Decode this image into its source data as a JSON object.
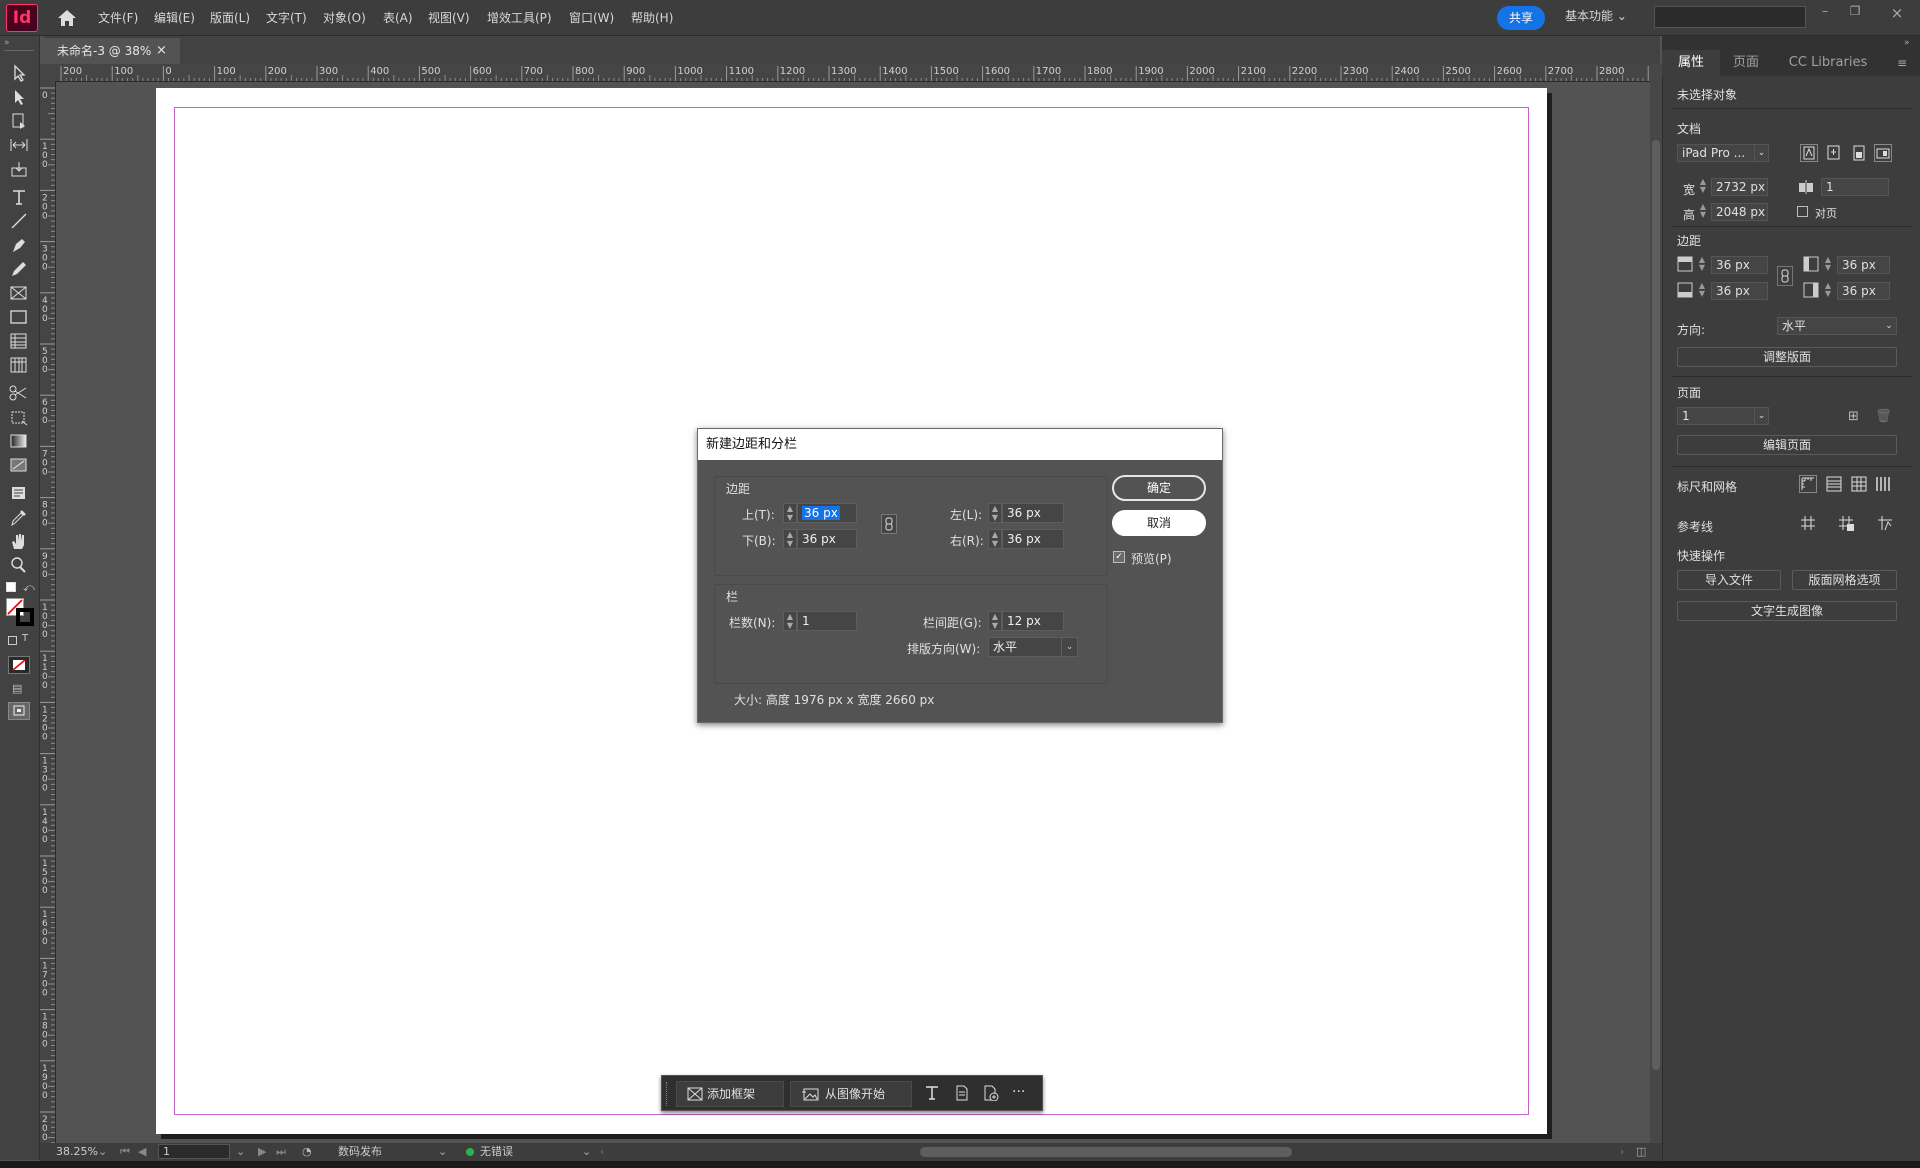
{
  "app": {
    "logo": "Id"
  },
  "menu": [
    "文件(F)",
    "编辑(E)",
    "版面(L)",
    "文字(T)",
    "对象(O)",
    "表(A)",
    "视图(V)",
    "增效工具(P)",
    "窗口(W)",
    "帮助(H)"
  ],
  "share_label": "共享",
  "workspace_label": "基本功能",
  "document_tab": {
    "title": "未命名-3 @ 38%",
    "close": "×"
  },
  "ruler": {
    "h_ticks": [
      "200",
      "100",
      "0",
      "100",
      "200",
      "300",
      "400",
      "500",
      "600",
      "700",
      "800",
      "900",
      "1000",
      "1100",
      "1200",
      "1300",
      "1400",
      "1500",
      "1600",
      "1700",
      "1800",
      "1900",
      "2000",
      "2100",
      "2200",
      "2300",
      "2400",
      "2500",
      "2600",
      "2700",
      "2800",
      "29"
    ],
    "v_ticks": [
      "0",
      "100",
      "200",
      "300",
      "400",
      "500",
      "600",
      "700",
      "800",
      "900",
      "1000",
      "1100",
      "1200",
      "1300",
      "1400",
      "1500",
      "1600",
      "1700",
      "1800",
      "1900",
      "200"
    ]
  },
  "properties_panel": {
    "tabs": [
      "属性",
      "页面",
      "CC Libraries"
    ],
    "no_selection": "未选择对象",
    "document_label": "文档",
    "preset": "iPad Pro ...",
    "width_label": "宽",
    "width": "2732 px",
    "height_label": "高",
    "height": "2048 px",
    "pages_count": "1",
    "facing_pages": "对页",
    "margins_label": "边距",
    "margin_top": "36 px",
    "margin_bottom": "36 px",
    "margin_left": "36 px",
    "margin_right": "36 px",
    "orientation_label": "方向:",
    "orientation_value": "水平",
    "adjust_layout": "调整版面",
    "page_label": "页面",
    "page_value": "1",
    "edit_page": "编辑页面",
    "rulers_grids": "标尺和网格",
    "guides": "参考线",
    "quick_actions": "快速操作",
    "import_file": "导入文件",
    "layout_grid_options": "版面网格选项",
    "text_to_image": "文字生成图像"
  },
  "dialog": {
    "title": "新建边距和分栏",
    "margins_group": "边距",
    "top_label": "上(T):",
    "top_value": "36 px",
    "bottom_label": "下(B):",
    "bottom_value": "36 px",
    "left_label": "左(L):",
    "left_value": "36 px",
    "right_label": "右(R):",
    "right_value": "36 px",
    "columns_group": "栏",
    "columns_label": "栏数(N):",
    "columns_value": "1",
    "gutter_label": "栏间距(G):",
    "gutter_value": "12 px",
    "direction_label": "排版方向(W):",
    "direction_value": "水平",
    "size_text": "大小: 高度 1976 px x 宽度 2660 px",
    "ok": "确定",
    "cancel": "取消",
    "preview": "预览(P)",
    "preview_checked": true
  },
  "context_bar": {
    "add_frame": "添加框架",
    "start_from_image": "从图像开始",
    "more": "···"
  },
  "status_bar": {
    "zoom": "38.25%",
    "page": "1",
    "profile": "数码发布",
    "errors": "无错误"
  },
  "colors": {
    "accent": "#1473e6",
    "logo": "#ff3366",
    "margin_guide": "#c663c6",
    "ok_dot": "#2db34a"
  }
}
